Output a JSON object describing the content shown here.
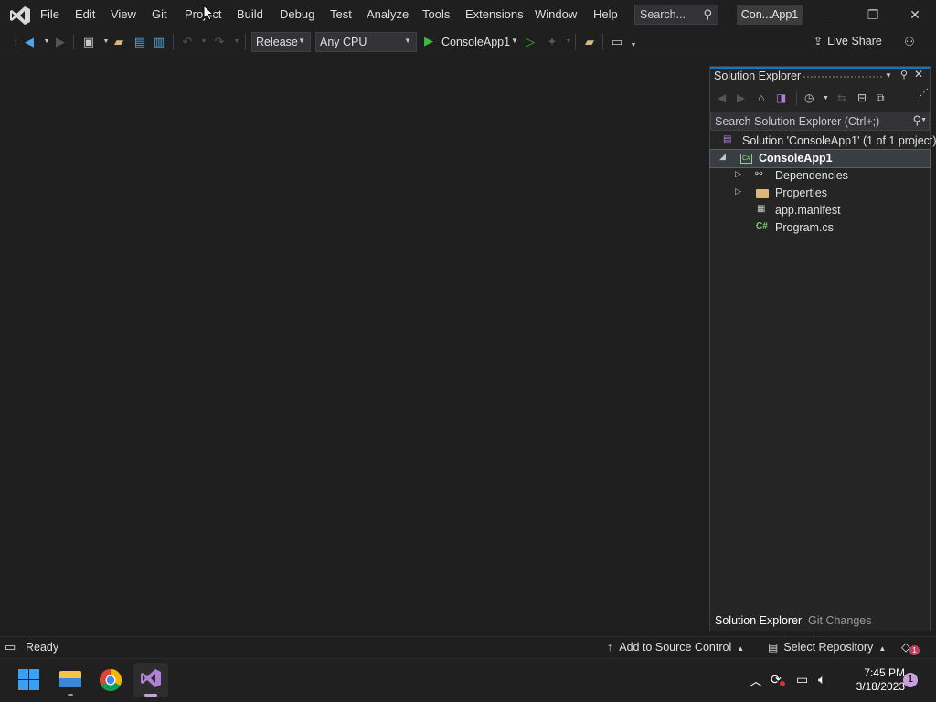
{
  "titlebar": {
    "menu": [
      "File",
      "Edit",
      "View",
      "Git",
      "Project",
      "Build",
      "Debug",
      "Test",
      "Analyze",
      "Tools",
      "Extensions",
      "Window",
      "Help"
    ],
    "search_label": "Search...",
    "solution_name": "Con...App1",
    "minimize_glyph": "—",
    "restore_glyph": "❐",
    "close_glyph": "✕"
  },
  "toolbar": {
    "configuration": "Release",
    "platform": "Any CPU",
    "start_target": "ConsoleApp1",
    "live_share": "Live Share"
  },
  "solution_explorer": {
    "title": "Solution Explorer",
    "search_placeholder": "Search Solution Explorer (Ctrl+;)",
    "tree": {
      "solution": "Solution 'ConsoleApp1' (1 of 1 project)",
      "project": "ConsoleApp1",
      "dependencies": "Dependencies",
      "properties": "Properties",
      "manifest": "app.manifest",
      "program": "Program.cs"
    },
    "tabs": [
      "Solution Explorer",
      "Git Changes"
    ],
    "project_icon_text": "C#",
    "cs_icon_text": "C#"
  },
  "statusbar": {
    "status": "Ready",
    "source_control": "Add to Source Control",
    "repository": "Select Repository",
    "notifications": "1"
  },
  "taskbar": {
    "time": "7:45 PM",
    "date": "3/18/2023",
    "badge": "1"
  },
  "colors": {
    "accent": "#007acc",
    "run_green": "#3fb83f",
    "vs_purple": "#b180d7"
  }
}
